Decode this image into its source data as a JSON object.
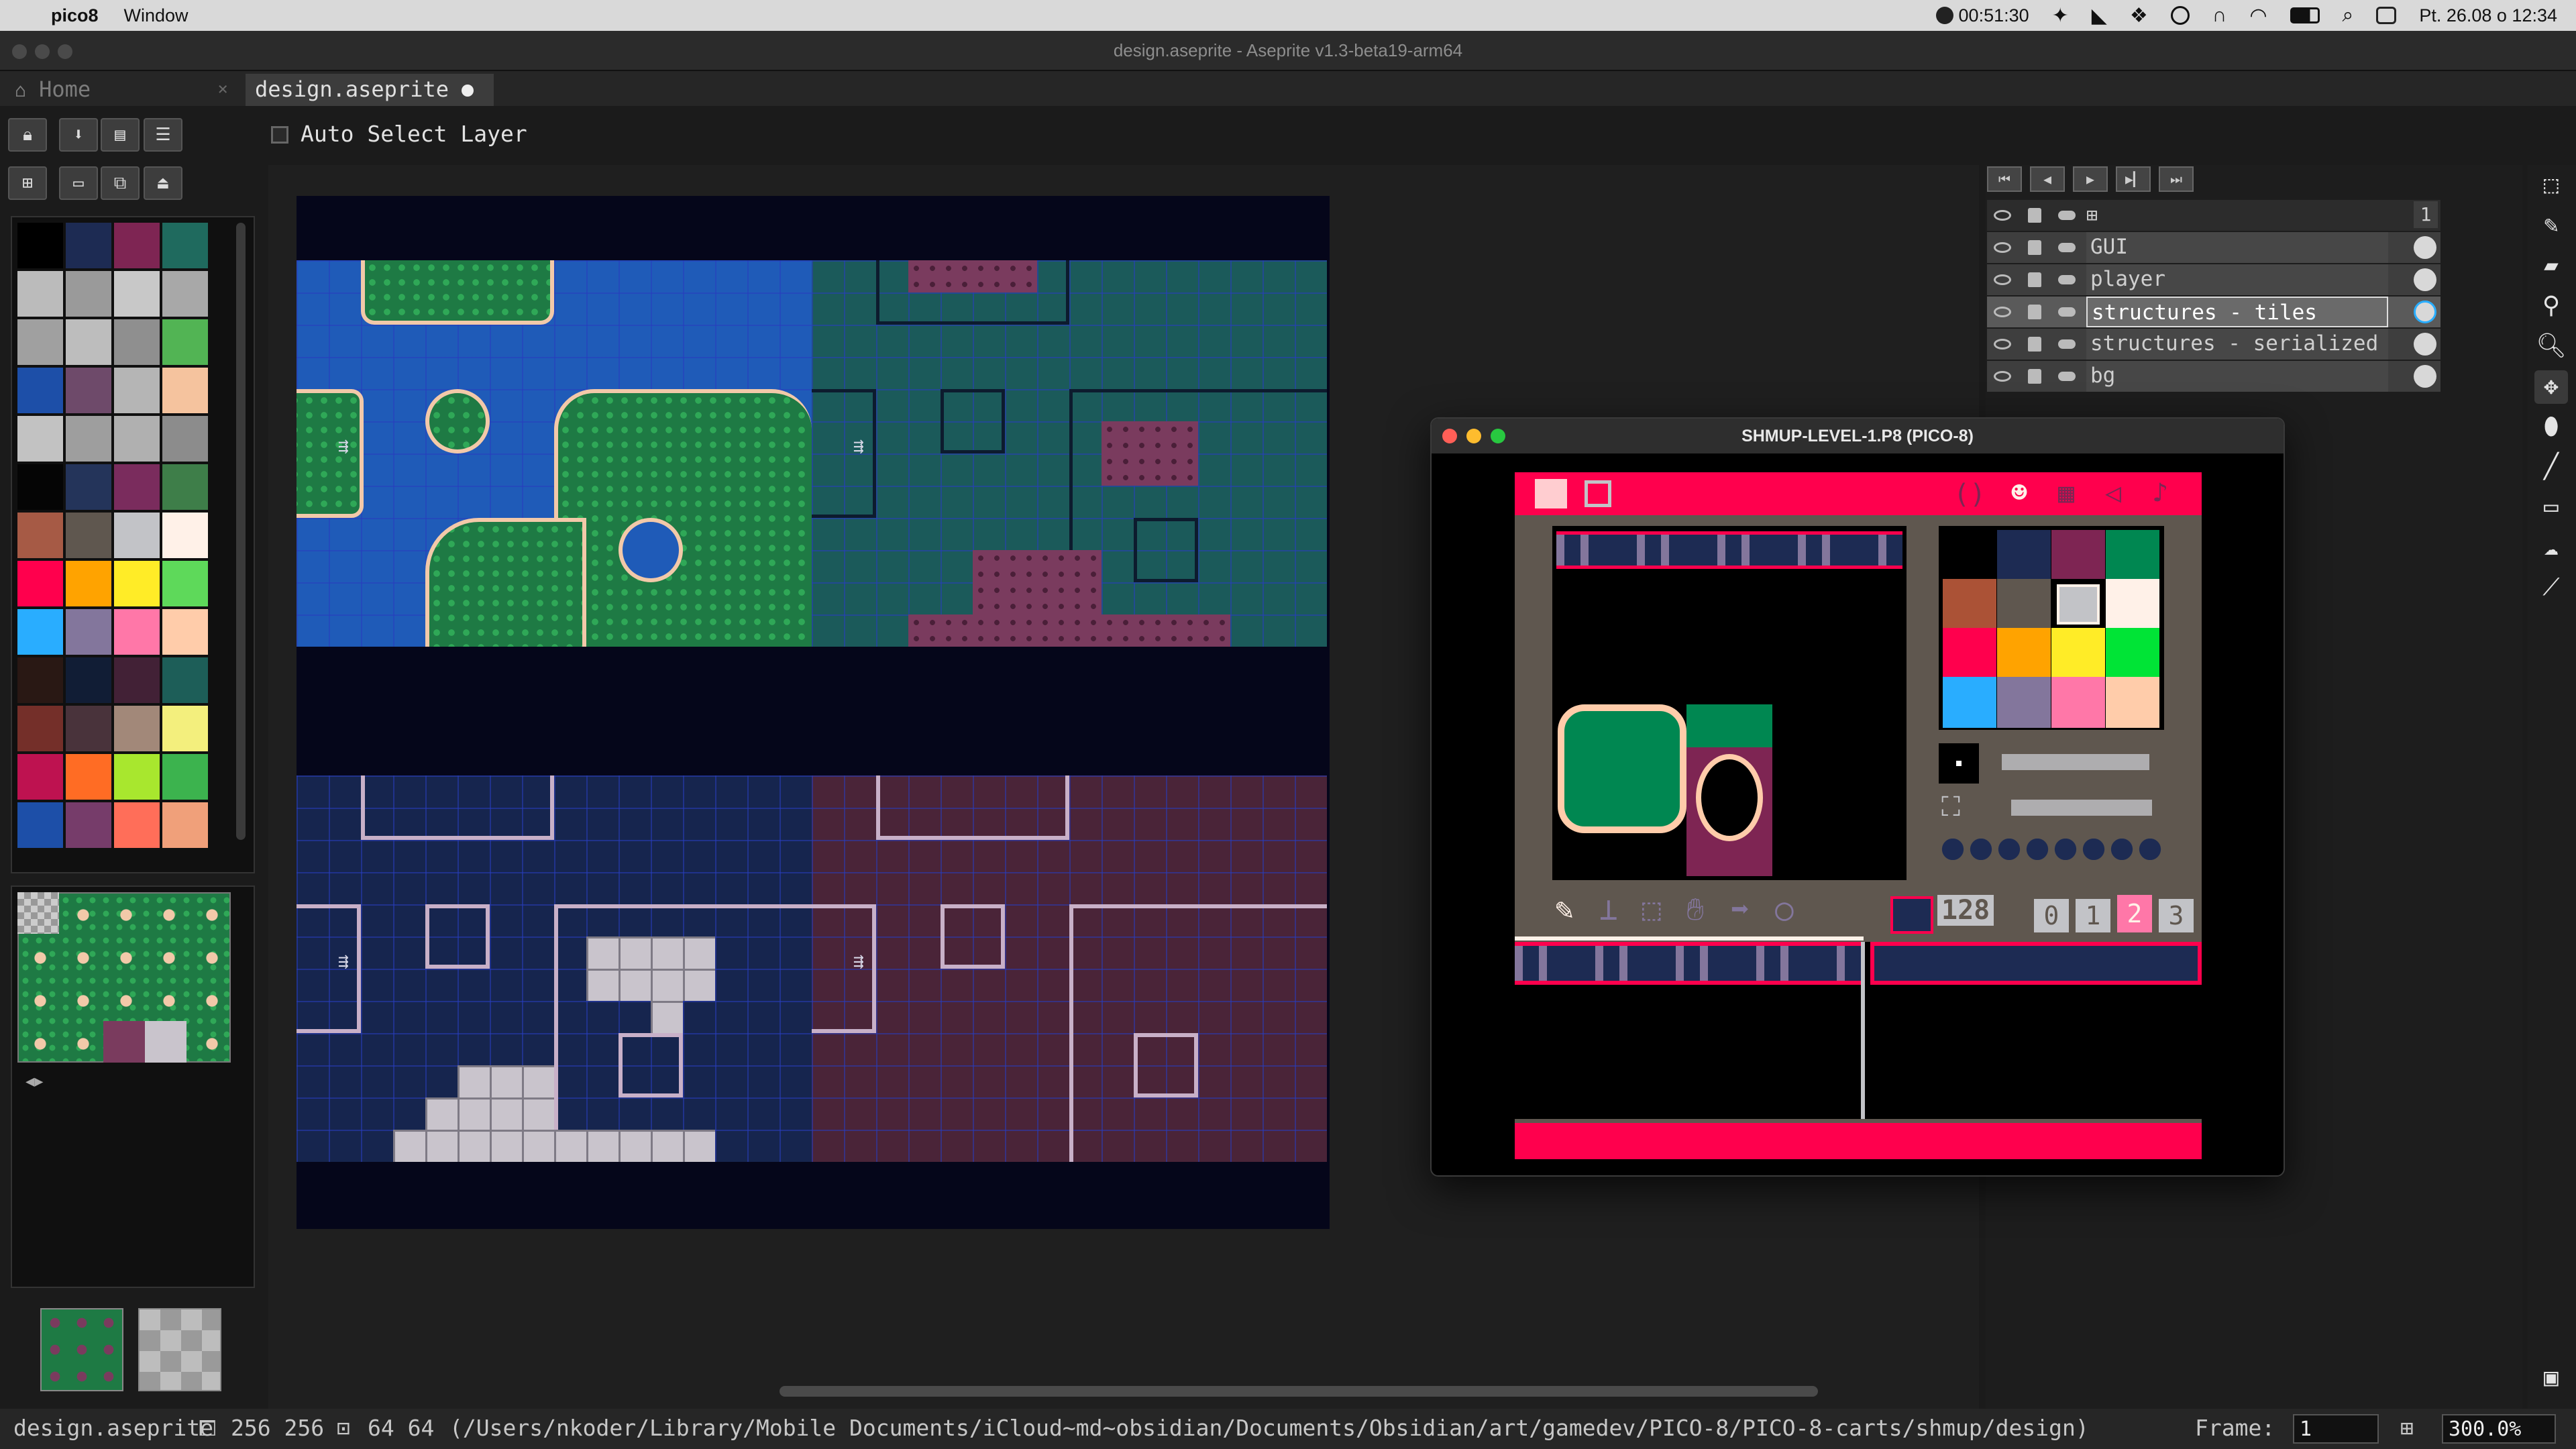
{
  "menubar": {
    "app_name": "pico8",
    "menu_window": "Window",
    "timer": "00:51:30",
    "clock": "Pt. 26.08 o 12:34"
  },
  "window": {
    "title": "design.aseprite - Aseprite v1.3-beta19-arm64"
  },
  "tabs": {
    "home": "Home",
    "home_close": "×",
    "design": "design.aseprite"
  },
  "toolbar": {
    "auto_select_layer": "Auto Select Layer"
  },
  "palette_colors": [
    "#000000",
    "#1d2b53",
    "#7e2553",
    "#1f6a5e",
    "#bbbbbb",
    "#9a9a9a",
    "#c8c8c8",
    "#a8a8a8",
    "#a0a0a0",
    "#bdbdbd",
    "#8f8f8f",
    "#52b454",
    "#1d4fa8",
    "#6e4a6a",
    "#b5b5b5",
    "#f5c39e",
    "#c2c2c2",
    "#9e9e9e",
    "#b0b0b0",
    "#8c8c8c",
    "#050505",
    "#24345a",
    "#7a2c5d",
    "#3e7e49",
    "#a65a45",
    "#5f574f",
    "#c2c3c7",
    "#fff1e8",
    "#ff004d",
    "#ffa300",
    "#ffec27",
    "#5ed95a",
    "#29adff",
    "#83769c",
    "#ff77a8",
    "#ffccaa",
    "#291814",
    "#111d35",
    "#422136",
    "#1d5e58",
    "#742f29",
    "#49333b",
    "#a28879",
    "#f3ef7d",
    "#be1250",
    "#ff6c24",
    "#a8e72e",
    "#3cb34e",
    "#1d4fa8",
    "#763c6a",
    "#ff6e59",
    "#f0a07a"
  ],
  "layers": [
    {
      "name": "",
      "cel": "1"
    },
    {
      "name": "GUI",
      "cel": ""
    },
    {
      "name": "player",
      "cel": ""
    },
    {
      "name": "structures - tiles",
      "cel": ""
    },
    {
      "name": "structures - serialized",
      "cel": ""
    },
    {
      "name": "bg",
      "cel": ""
    }
  ],
  "pico": {
    "title": "SHMUP-LEVEL-1.P8 (PICO-8)",
    "sprite_num": "128",
    "tabs": [
      "0",
      "1",
      "2",
      "3"
    ],
    "palette": [
      "#000000",
      "#1d2b53",
      "#7e2553",
      "#008751",
      "#ab5236",
      "#5f574f",
      "#c2c3c7",
      "#fff1e8",
      "#ff004d",
      "#ffa300",
      "#ffec27",
      "#00e436",
      "#29adff",
      "#83769c",
      "#ff77a8",
      "#ffccaa"
    ]
  },
  "status": {
    "filename": "design.aseprite",
    "canvas_size": "256 256",
    "grid_size": "64 64",
    "path": "(/Users/nkoder/Library/Mobile Documents/iCloud~md~obsidian/Documents/Obsidian/art/gamedev/PICO-8/PICO-8-carts/shmup/design)",
    "frame_label": "Frame:",
    "frame_value": "1",
    "zoom": "300.0%"
  }
}
